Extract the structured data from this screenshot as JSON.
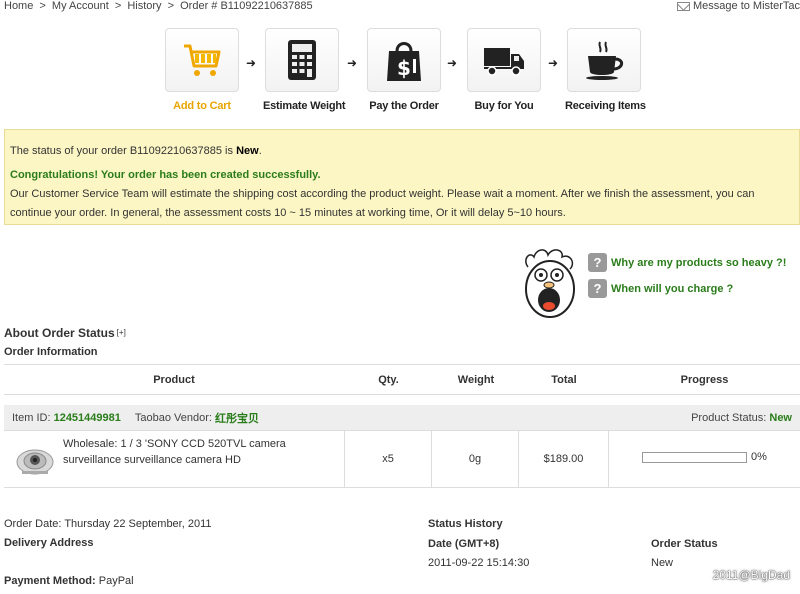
{
  "breadcrumb": {
    "home": "Home",
    "sep": ">",
    "account": "My Account",
    "history": "History",
    "order": "Order # B11092210637885"
  },
  "header": {
    "message_link": "Message to MisterTac"
  },
  "steps": [
    {
      "label": "Add to Cart",
      "icon": "cart-icon"
    },
    {
      "label": "Estimate Weight",
      "icon": "calculator-icon"
    },
    {
      "label": "Pay the Order",
      "icon": "shopping-bag-icon"
    },
    {
      "label": "Buy for You",
      "icon": "truck-icon"
    },
    {
      "label": "Receiving Items",
      "icon": "coffee-cup-icon"
    }
  ],
  "step_arrow": "➜",
  "notice": {
    "status_prefix": "The status of your order B11092210637885 is ",
    "status_value": "New",
    "status_suffix": ".",
    "congrats": "Congratulations! Your order has been created successfully.",
    "body": "Our Customer Service Team will estimate the shipping cost according the product weight. Please wait a moment. After we finish the assessment, you can continue your order. In general, the assessment costs 10 ~ 15 minutes at working time, Or it will delay 5~10 hours."
  },
  "faq": {
    "q1": "Why are my products so heavy ?!",
    "q2": "When will you charge ?",
    "icon": "?"
  },
  "sections": {
    "about_status": "About Order Status",
    "expand": "[+]",
    "order_info": "Order Information"
  },
  "table": {
    "headers": {
      "product": "Product",
      "qty": "Qty.",
      "weight": "Weight",
      "total": "Total",
      "progress": "Progress"
    }
  },
  "item": {
    "id_label": "Item ID: ",
    "id_value": "12451449981",
    "vendor_label": "Taobao Vendor: ",
    "vendor_value": "红彤宝贝",
    "status_label": "Product Status: ",
    "status_value": "New",
    "name": "Wholesale: 1 / 3 'SONY CCD 520TVL camera surveillance surveillance camera HD",
    "qty": "x5",
    "weight": "0g",
    "total": "$189.00",
    "progress_text": "0%",
    "progress_value": 0
  },
  "order": {
    "date_label": "Order Date: ",
    "date_value": "Thursday 22 September, 2011",
    "delivery_label": "Delivery Address",
    "payment_label": "Payment Method: ",
    "payment_value": "PayPal"
  },
  "status_history": {
    "title": "Status History",
    "date_header": "Date (GMT+8)",
    "status_header": "Order Status",
    "rows": [
      {
        "date": "2011-09-22 15:14:30",
        "status": "New"
      }
    ]
  },
  "watermark": "2011@BigDad",
  "colors": {
    "accent_green": "#2a7d1a",
    "active_step": "#e8a500",
    "notice_bg": "#fcf6c4"
  }
}
